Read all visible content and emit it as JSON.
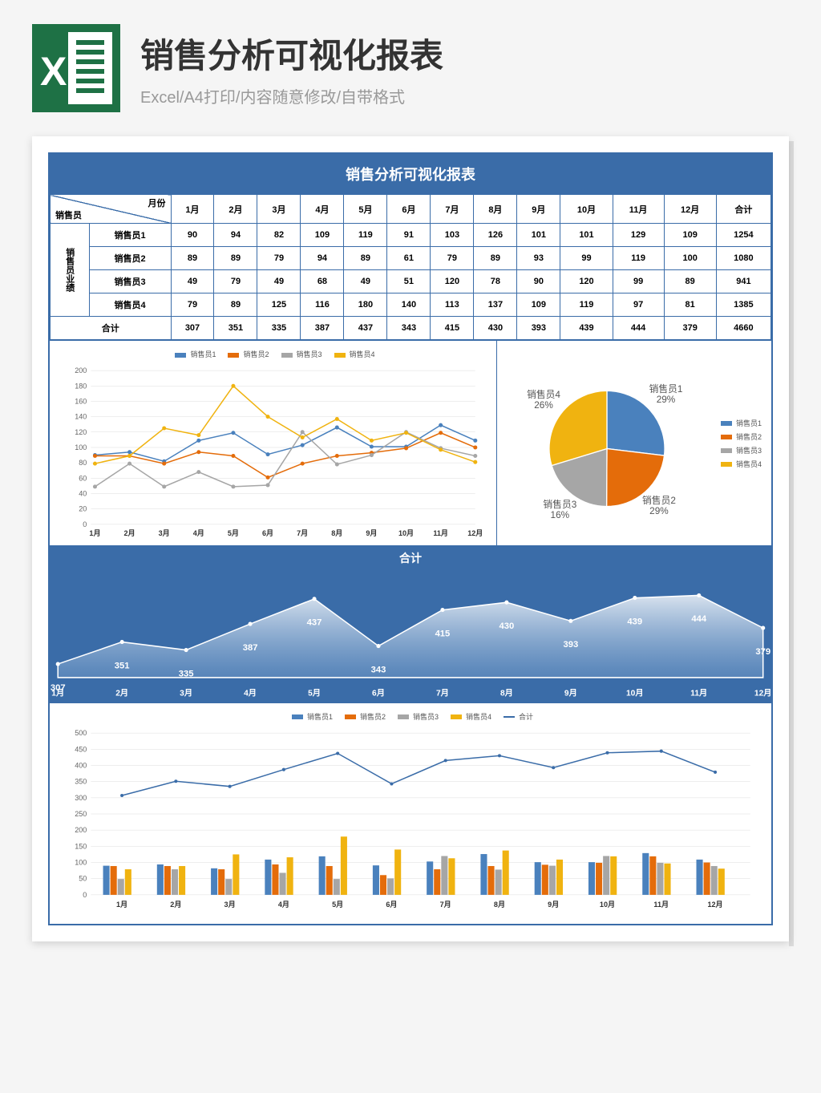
{
  "header": {
    "title": "销售分析可视化报表",
    "subtitle": "Excel/A4打印/内容随意修改/自带格式"
  },
  "report_title": "销售分析可视化报表",
  "table": {
    "corner_top": "月份",
    "corner_left": "销售员",
    "side_label": "销售员业绩",
    "months": [
      "1月",
      "2月",
      "3月",
      "4月",
      "5月",
      "6月",
      "7月",
      "8月",
      "9月",
      "10月",
      "11月",
      "12月"
    ],
    "total_label": "合计",
    "rows": [
      {
        "name": "销售员1",
        "vals": [
          90,
          94,
          82,
          109,
          119,
          91,
          103,
          126,
          101,
          101,
          129,
          109
        ],
        "total": 1254
      },
      {
        "name": "销售员2",
        "vals": [
          89,
          89,
          79,
          94,
          89,
          61,
          79,
          89,
          93,
          99,
          119,
          100
        ],
        "total": 1080
      },
      {
        "name": "销售员3",
        "vals": [
          49,
          79,
          49,
          68,
          49,
          51,
          120,
          78,
          90,
          120,
          99,
          89
        ],
        "total": 941
      },
      {
        "name": "销售员4",
        "vals": [
          79,
          89,
          125,
          116,
          180,
          140,
          113,
          137,
          109,
          119,
          97,
          81
        ],
        "total": 1385
      }
    ],
    "totals": [
      307,
      351,
      335,
      387,
      437,
      343,
      415,
      430,
      393,
      439,
      444,
      379
    ],
    "grand_total": 4660
  },
  "colors": {
    "s1": "#4a81bd",
    "s2": "#e46c0a",
    "s3": "#a6a6a6",
    "s4": "#f0b310",
    "line": "#3a6ca8"
  },
  "series_names": [
    "销售员1",
    "销售员2",
    "销售员3",
    "销售员4"
  ],
  "pie": {
    "labels": [
      "销售员1",
      "销售员2",
      "销售员3",
      "销售员4"
    ],
    "pct": [
      "29%",
      "29%",
      "16%",
      "26%"
    ]
  },
  "chart_data": [
    {
      "type": "line",
      "categories": [
        "1月",
        "2月",
        "3月",
        "4月",
        "5月",
        "6月",
        "7月",
        "8月",
        "9月",
        "10月",
        "11月",
        "12月"
      ],
      "series": [
        {
          "name": "销售员1",
          "values": [
            90,
            94,
            82,
            109,
            119,
            91,
            103,
            126,
            101,
            101,
            129,
            109
          ]
        },
        {
          "name": "销售员2",
          "values": [
            89,
            89,
            79,
            94,
            89,
            61,
            79,
            89,
            93,
            99,
            119,
            100
          ]
        },
        {
          "name": "销售员3",
          "values": [
            49,
            79,
            49,
            68,
            49,
            51,
            120,
            78,
            90,
            120,
            99,
            89
          ]
        },
        {
          "name": "销售员4",
          "values": [
            79,
            89,
            125,
            116,
            180,
            140,
            113,
            137,
            109,
            119,
            97,
            81
          ]
        }
      ],
      "ylim": [
        0,
        200
      ],
      "yticks": [
        0,
        20,
        40,
        60,
        80,
        100,
        120,
        140,
        160,
        180,
        200
      ]
    },
    {
      "type": "pie",
      "title": "",
      "series": [
        {
          "name": "销售员1",
          "value": 1254
        },
        {
          "name": "销售员2",
          "value": 1080
        },
        {
          "name": "销售员3",
          "value": 941
        },
        {
          "name": "销售员4",
          "value": 1385
        }
      ],
      "pct": [
        "29%",
        "29%",
        "16%",
        "26%"
      ]
    },
    {
      "type": "area",
      "title": "合计",
      "categories": [
        "1月",
        "2月",
        "3月",
        "4月",
        "5月",
        "6月",
        "7月",
        "8月",
        "9月",
        "10月",
        "11月",
        "12月"
      ],
      "values": [
        307,
        351,
        335,
        387,
        437,
        343,
        415,
        430,
        393,
        439,
        444,
        379
      ]
    },
    {
      "type": "bar",
      "categories": [
        "1月",
        "2月",
        "3月",
        "4月",
        "5月",
        "6月",
        "7月",
        "8月",
        "9月",
        "10月",
        "11月",
        "12月"
      ],
      "series": [
        {
          "name": "销售员1",
          "values": [
            90,
            94,
            82,
            109,
            119,
            91,
            103,
            126,
            101,
            101,
            129,
            109
          ]
        },
        {
          "name": "销售员2",
          "values": [
            89,
            89,
            79,
            94,
            89,
            61,
            79,
            89,
            93,
            99,
            119,
            100
          ]
        },
        {
          "name": "销售员3",
          "values": [
            49,
            79,
            49,
            68,
            49,
            51,
            120,
            78,
            90,
            120,
            99,
            89
          ]
        },
        {
          "name": "销售员4",
          "values": [
            79,
            89,
            125,
            116,
            180,
            140,
            113,
            137,
            109,
            119,
            97,
            81
          ]
        }
      ],
      "line_series": {
        "name": "合计",
        "values": [
          307,
          351,
          335,
          387,
          437,
          343,
          415,
          430,
          393,
          439,
          444,
          379
        ]
      },
      "ylim": [
        0,
        500
      ],
      "yticks": [
        0,
        50,
        100,
        150,
        200,
        250,
        300,
        350,
        400,
        450,
        500
      ]
    }
  ]
}
